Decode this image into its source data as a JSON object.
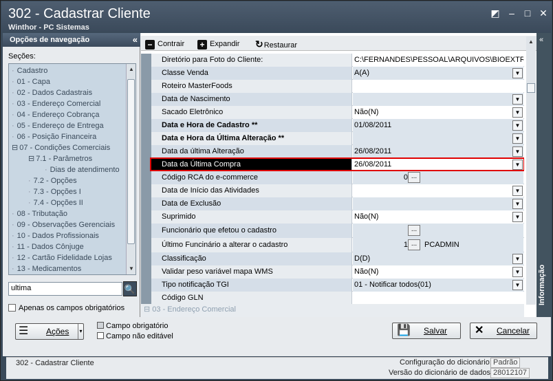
{
  "window": {
    "title": "302 - Cadastrar Cliente",
    "subtitle": "Winthor - PC Sistemas",
    "controls": [
      "resize-icon",
      "minimize-icon",
      "maximize-icon",
      "close-icon"
    ]
  },
  "nav": {
    "header": "Opções de navegação",
    "sections_label": "Seções:",
    "items": [
      {
        "label": "Cadastro",
        "indent": 0
      },
      {
        "label": "01 - Capa",
        "indent": 0
      },
      {
        "label": "02 - Dados Cadastrais",
        "indent": 0
      },
      {
        "label": "03 - Endereço Comercial",
        "indent": 0
      },
      {
        "label": "04 - Endereço Cobrança",
        "indent": 0
      },
      {
        "label": "05 - Endereço de Entrega",
        "indent": 0
      },
      {
        "label": "06 - Posição Financeira",
        "indent": 0
      },
      {
        "label": "07 - Condições Comerciais",
        "indent": 0,
        "expander": "⊟"
      },
      {
        "label": "7.1 - Parâmetros",
        "indent": 1,
        "expander": "⊟"
      },
      {
        "label": "Dias de atendimento",
        "indent": 2
      },
      {
        "label": "7.2 - Opções",
        "indent": 1
      },
      {
        "label": "7.3 - Opções I",
        "indent": 1
      },
      {
        "label": "7.4 - Opções II",
        "indent": 1
      },
      {
        "label": "08 - Tributação",
        "indent": 0
      },
      {
        "label": "09 - Observações Gerenciais",
        "indent": 0
      },
      {
        "label": "10 - Dados Profissionais",
        "indent": 0
      },
      {
        "label": "11 - Dados Cônjuge",
        "indent": 0
      },
      {
        "label": "12 - Cartão Fidelidade Lojas",
        "indent": 0
      },
      {
        "label": "13 - Medicamentos",
        "indent": 0
      }
    ],
    "search_value": "ultima",
    "only_required_label": "Apenas os campos obrigatórios"
  },
  "toolbar": {
    "collapse_label": "Contrair",
    "expand_label": "Expandir",
    "restore_label": "Restaurar"
  },
  "grid": {
    "rows": [
      {
        "label": "Diretório para Foto do Cliente:",
        "value": "C:\\FERNANDES\\PESSOAL\\ARQUIVOS\\BIOEXTRATUS",
        "control": "none"
      },
      {
        "label": "Classe Venda",
        "value": "A(A)",
        "control": "dropdown"
      },
      {
        "label": "Roteiro MasterFoods",
        "value": "",
        "control": "none"
      },
      {
        "label": "Data de Nascimento",
        "value": "",
        "control": "dropdown"
      },
      {
        "label": "Sacado Eletrônico",
        "value": "Não(N)",
        "control": "dropdown"
      },
      {
        "label": "Data e Hora de Cadastro **",
        "value": "01/08/2011",
        "control": "dropdown",
        "bold": true,
        "readonly": true
      },
      {
        "label": "Data e Hora da Última Alteração **",
        "value": "",
        "control": "dropdown",
        "bold": true,
        "readonly": true
      },
      {
        "label": "Data da última Alteração",
        "value": "26/08/2011",
        "control": "dropdown",
        "readonly": true
      },
      {
        "label": "Data da Última Compra",
        "value": "26/08/2011",
        "control": "dropdown",
        "selected": true
      },
      {
        "label": "Código RCA do e-commerce",
        "value": "0",
        "control": "ellipsis",
        "align": "right"
      },
      {
        "label": "Data de Início das Atividades",
        "value": "",
        "control": "dropdown"
      },
      {
        "label": "Data de Exclusão",
        "value": "",
        "control": "dropdown"
      },
      {
        "label": "Suprimido",
        "value": "Não(N)",
        "control": "dropdown"
      },
      {
        "label": "Funcionário que efetou o cadastro",
        "value": "",
        "control": "ellipsis",
        "readonly": true,
        "tall": true
      },
      {
        "label": "Último Funcinário a alterar o cadastro",
        "value": "1",
        "control": "ellipsis",
        "extra": "PCADMIN",
        "readonly": true,
        "tall": true
      },
      {
        "label": "Classificação",
        "value": "D(D)",
        "control": "dropdown"
      },
      {
        "label": "Validar peso variável mapa WMS",
        "value": "Não(N)",
        "control": "dropdown"
      },
      {
        "label": "Tipo notificação TGI",
        "value": "01 - Notificar todos(01)",
        "control": "dropdown"
      },
      {
        "label": "Código GLN",
        "value": "",
        "control": "none"
      }
    ],
    "footer_group": "03 - Endereço Comercial"
  },
  "info_panel": {
    "label": "Informação"
  },
  "bottom": {
    "actions_label": "Ações",
    "legend_required": "Campo obrigatório",
    "legend_readonly": "Campo não editável",
    "save_label": "Salvar",
    "cancel_label": "Cancelar"
  },
  "status": {
    "left": "302 - Cadastrar Cliente",
    "dict_config_label": "Configuração do dicionário:",
    "dict_config_value": "Padrão",
    "dict_version_label": "Versão do dicionário de dados:",
    "dict_version_value": "28012107"
  },
  "colors": {
    "titlebar": "#3b4a5b",
    "selected_row_border": "#e00000",
    "label_bg": "#e8ecf0",
    "alt_bg": "#d5dee8"
  }
}
